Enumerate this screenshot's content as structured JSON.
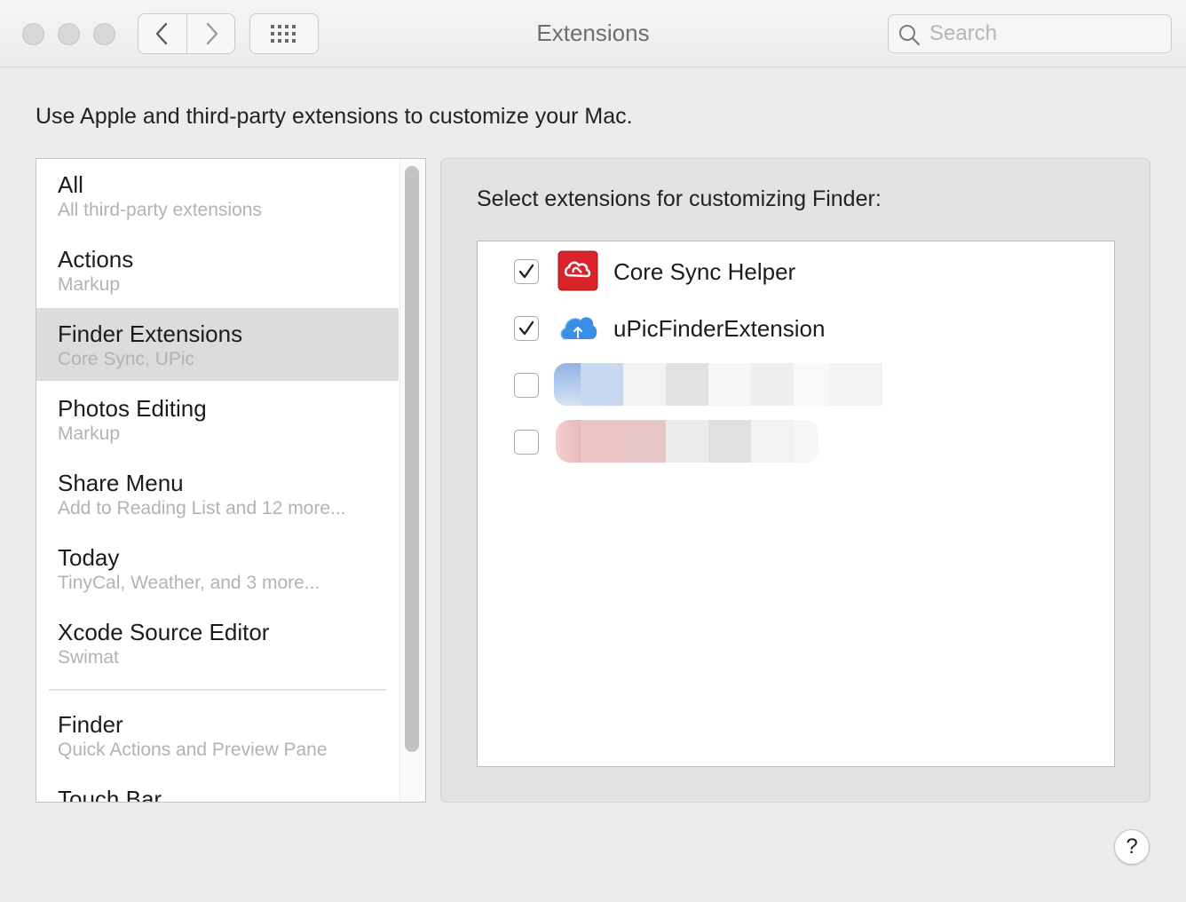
{
  "window": {
    "title": "Extensions"
  },
  "search": {
    "placeholder": "Search"
  },
  "intro": "Use Apple and third-party extensions to customize your Mac.",
  "sidebar": {
    "items": [
      {
        "title": "All",
        "subtitle": "All third-party extensions"
      },
      {
        "title": "Actions",
        "subtitle": "Markup"
      },
      {
        "title": "Finder Extensions",
        "subtitle": "Core Sync, UPic",
        "selected": true
      },
      {
        "title": "Photos Editing",
        "subtitle": "Markup"
      },
      {
        "title": "Share Menu",
        "subtitle": "Add to Reading List and 12 more..."
      },
      {
        "title": "Today",
        "subtitle": "TinyCal, Weather, and 3 more..."
      },
      {
        "title": "Xcode Source Editor",
        "subtitle": "Swimat"
      },
      {
        "title": "Finder",
        "subtitle": "Quick Actions and Preview Pane"
      },
      {
        "title": "Touch Bar",
        "subtitle": ""
      }
    ]
  },
  "panel": {
    "heading": "Select extensions for customizing Finder:",
    "extensions": [
      {
        "name": "Core Sync Helper",
        "checked": true,
        "icon": "creative-cloud-icon"
      },
      {
        "name": "uPicFinderExtension",
        "checked": true,
        "icon": "cloud-upload-icon"
      },
      {
        "name": "",
        "checked": false,
        "icon": "redacted-icon"
      },
      {
        "name": "",
        "checked": false,
        "icon": "redacted-icon"
      }
    ]
  },
  "help": {
    "label": "?"
  },
  "colors": {
    "selection": "#dcdcdc",
    "adobe_red": "#da1f26",
    "cloud_blue": "#3a8ee6"
  }
}
